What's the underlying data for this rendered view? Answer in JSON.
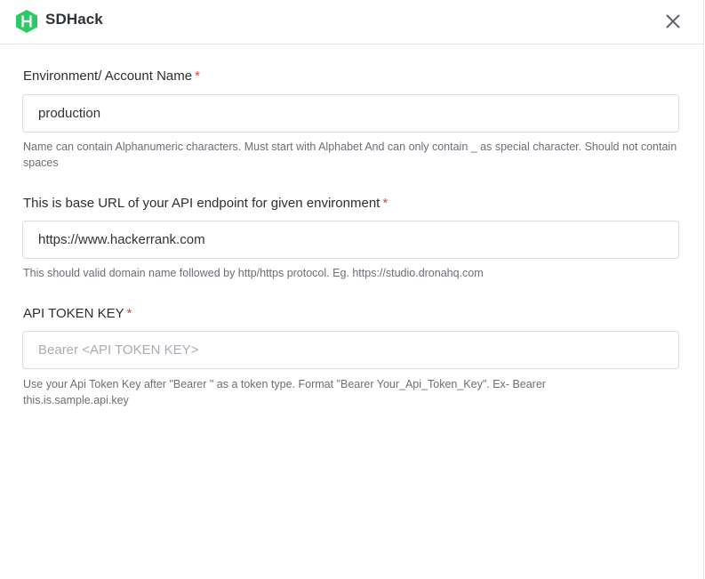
{
  "header": {
    "app_title": "SDHack",
    "logo_icon": "hackerrank-hexagon-logo",
    "close_icon": "close-icon",
    "brand_color": "#2ec866"
  },
  "form": {
    "environment": {
      "label": "Environment/ Account Name",
      "required_mark": "*",
      "value": "production",
      "help": "Name can contain Alphanumeric characters. Must start with Alphabet And can only contain _ as special character. Should not contain spaces"
    },
    "base_url": {
      "label": "This is base URL of your API endpoint for given environment",
      "required_mark": "*",
      "value": "https://www.hackerrank.com",
      "help": "This should valid domain name followed by http/https protocol. Eg. https://studio.dronahq.com"
    },
    "api_token": {
      "label": "API TOKEN KEY",
      "required_mark": "*",
      "value": "",
      "placeholder": "Bearer <API TOKEN KEY>",
      "help": "Use your Api Token Key after \"Bearer \" as a token type. Format \"Bearer Your_Api_Token_Key\". Ex- Bearer this.is.sample.api.key"
    }
  },
  "colors": {
    "required": "#e0433b",
    "help_text": "#6b6f76",
    "input_border": "#d9dce1"
  }
}
